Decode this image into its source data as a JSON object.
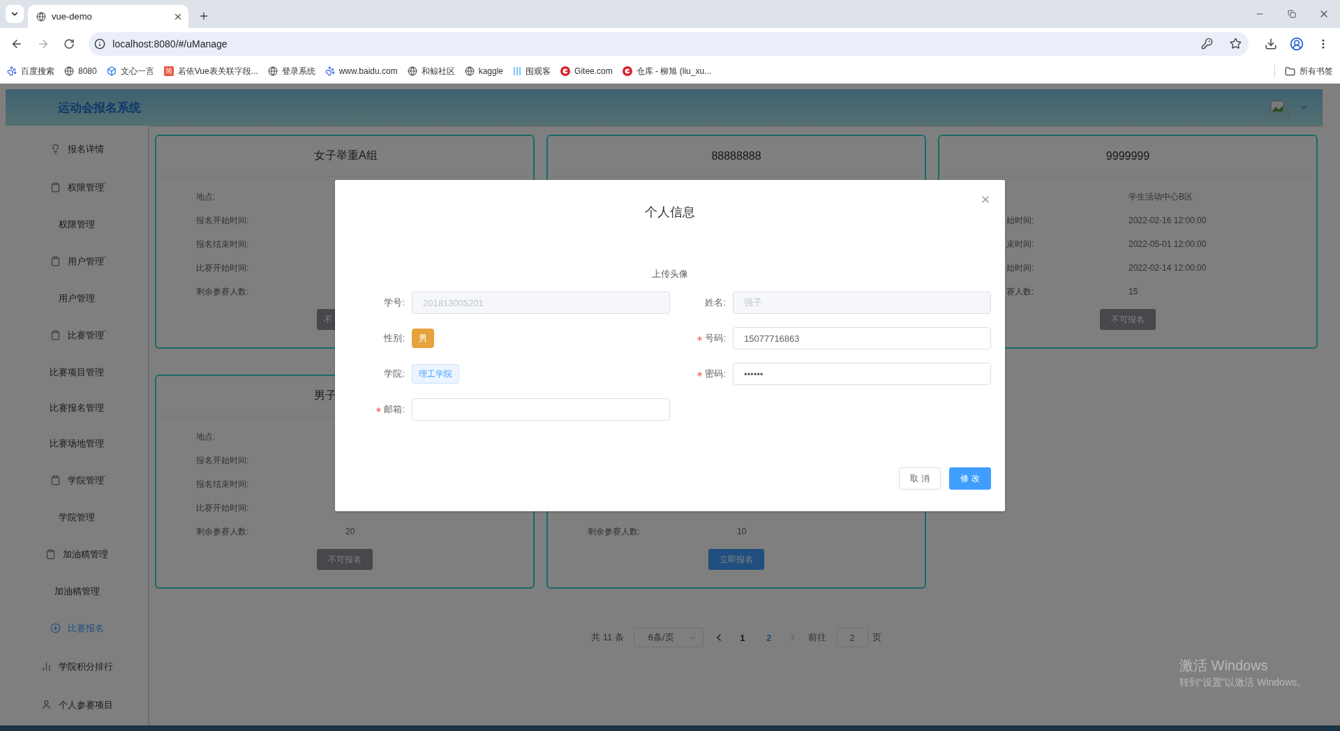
{
  "browser": {
    "tab": {
      "title": "vue-demo"
    },
    "url": "localhost:8080/#/uManage",
    "bookmarks": [
      {
        "kind": "paw",
        "label": "百度搜索"
      },
      {
        "kind": "globe",
        "label": "8080"
      },
      {
        "kind": "cube",
        "label": "文心一言"
      },
      {
        "kind": "text",
        "badge": "简",
        "label": "若依Vue表关联字段..."
      },
      {
        "kind": "globe",
        "label": "登录系统"
      },
      {
        "kind": "paw",
        "label": "www.baidu.com"
      },
      {
        "kind": "globe",
        "label": "和鲸社区"
      },
      {
        "kind": "globe",
        "label": "kaggle"
      },
      {
        "kind": "stripes",
        "label": "围观客"
      },
      {
        "kind": "ring",
        "label": "Gitee.com"
      },
      {
        "kind": "ring",
        "label": "仓库 - 柳旭 (liu_xu..."
      }
    ],
    "all_bookmarks": "所有书签"
  },
  "app": {
    "title": "运动会报名系统"
  },
  "sidebar": {
    "items": [
      {
        "kind": "link",
        "label": "报名详情",
        "selected": false
      },
      {
        "kind": "group",
        "label": "权限管理",
        "expanded": true,
        "children": [
          {
            "label": "权限管理",
            "selected": false
          }
        ]
      },
      {
        "kind": "group",
        "label": "用户管理",
        "expanded": true,
        "children": [
          {
            "label": "用户管理",
            "selected": false
          }
        ]
      },
      {
        "kind": "group",
        "label": "比赛管理",
        "expanded": true,
        "children": [
          {
            "label": "比赛项目管理",
            "selected": false
          },
          {
            "label": "比赛报名管理",
            "selected": false
          },
          {
            "label": "比赛场地管理",
            "selected": false
          }
        ]
      },
      {
        "kind": "group",
        "label": "学院管理",
        "expanded": true,
        "children": [
          {
            "label": "学院管理",
            "selected": false
          }
        ]
      },
      {
        "kind": "group",
        "label": "加油稿管理",
        "expanded": true,
        "children": [
          {
            "label": "加油稿管理",
            "selected": false
          }
        ]
      },
      {
        "kind": "link",
        "label": "比赛报名",
        "selected": true
      },
      {
        "kind": "link",
        "label": "学院积分排行",
        "selected": false
      },
      {
        "kind": "link",
        "label": "个人参赛项目",
        "selected": false
      }
    ]
  },
  "cards": [
    {
      "title": "女子举重A组",
      "fields": [
        {
          "label": "地点:"
        },
        {
          "label": "报名开始时间:"
        },
        {
          "label": "报名结束时间:"
        },
        {
          "label": "比赛开始时间:"
        },
        {
          "label": "剩余参赛人数:"
        }
      ],
      "button": {
        "label": "不",
        "kind": "disabled"
      }
    },
    {
      "title": "88888888"
    },
    {
      "title": "9999999",
      "fields": [
        {
          "value": "学生活动中心B区"
        },
        {
          "label": "始时间:",
          "value": "2022-02-16 12:00:00"
        },
        {
          "label": "束时间:",
          "value": "2022-05-01 12:00:00"
        },
        {
          "label": "始时间:",
          "value": "2022-02-14 12:00:00"
        },
        {
          "label": "赛人数:",
          "value": "15"
        }
      ],
      "button": {
        "label": "不可报名",
        "kind": "disabled"
      }
    },
    {
      "title": "男子",
      "fields": [
        {
          "label": "地点:"
        },
        {
          "label": "报名开始时间:"
        },
        {
          "label": "报名结束时间:"
        },
        {
          "label": "比赛开始时间:"
        },
        {
          "label": "剩余参赛人数:",
          "value": "20"
        }
      ],
      "button": {
        "label": "不可报名",
        "kind": "disabled"
      }
    },
    {
      "fields": [
        {
          "label": "剩余参赛人数:",
          "value": "10"
        }
      ],
      "button": {
        "label": "立即报名",
        "kind": "primary"
      }
    }
  ],
  "pagination": {
    "total": "共 11 条",
    "page_size": "6条/页",
    "pages": [
      {
        "label": "1",
        "selected": false
      },
      {
        "label": "2",
        "selected": true
      }
    ],
    "goto_label": "前往",
    "goto_value": "2",
    "goto_suffix": "页"
  },
  "dialog": {
    "title": "个人信息",
    "upload_label": "上传头像",
    "fields": [
      {
        "kind": "disabled",
        "label": "学号:",
        "required": false,
        "value": "201813005201"
      },
      {
        "kind": "disabled",
        "label": "姓名:",
        "required": false,
        "value": "强子"
      },
      {
        "kind": "solid-tag",
        "label": "性别:",
        "required": false,
        "value": "男"
      },
      {
        "kind": "input",
        "label": "号码:",
        "required": true,
        "value": "15077716863"
      },
      {
        "kind": "light-tag",
        "label": "学院:",
        "required": false,
        "value": "理工学院"
      },
      {
        "kind": "input",
        "label": "密码:",
        "required": true,
        "value": "••••••"
      },
      {
        "kind": "input",
        "label": "邮箱:",
        "required": true
      }
    ],
    "buttons": [
      {
        "kind": "default",
        "label": "取 消"
      },
      {
        "kind": "primary",
        "label": "修 改"
      }
    ]
  },
  "os_notice": {
    "title": "激活 Windows",
    "text": "转到“设置”以激活 Windows。"
  }
}
